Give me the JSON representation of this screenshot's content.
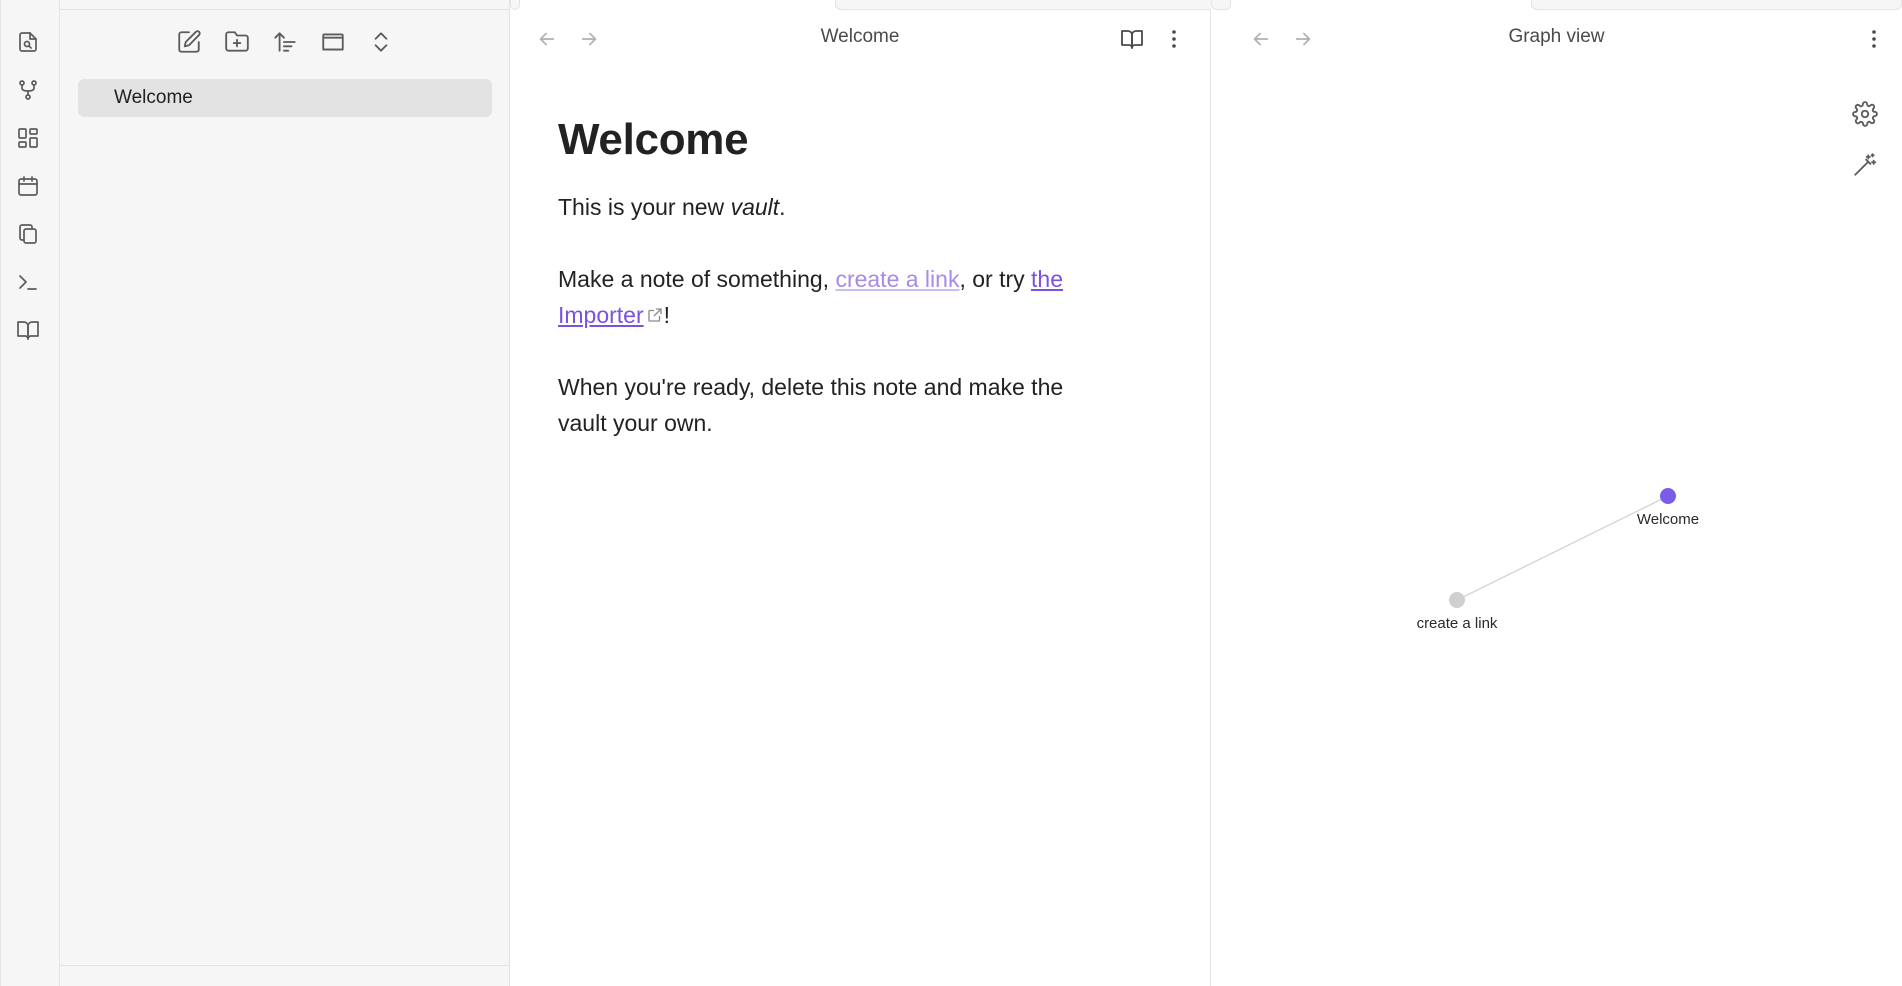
{
  "ribbon": {
    "items": [
      {
        "name": "open-quick-switcher-icon"
      },
      {
        "name": "graph-view-icon"
      },
      {
        "name": "canvas-icon"
      },
      {
        "name": "daily-note-icon"
      },
      {
        "name": "templates-icon"
      },
      {
        "name": "command-palette-icon"
      },
      {
        "name": "help-icon"
      }
    ]
  },
  "sidebar": {
    "toolbar": [
      "new-note-icon",
      "new-folder-icon",
      "sort-icon",
      "collapse-icon",
      "expand-all-icon"
    ],
    "files": [
      {
        "label": "Welcome"
      }
    ]
  },
  "editor": {
    "title": "Welcome",
    "note": {
      "heading": "Welcome",
      "p1_before": "This is your new ",
      "p1_em": "vault",
      "p1_after": ".",
      "p2_before": "Make a note of something, ",
      "p2_link1": "create a link",
      "p2_mid": ", or try ",
      "p2_link2a": "the ",
      "p2_link2b": "Importer",
      "p2_after": "!",
      "p3_line1": "When you're ready, delete this note and make the",
      "p3_line2": "vault your own."
    }
  },
  "graph": {
    "title": "Graph view",
    "nodes": [
      {
        "label": "Welcome",
        "color": "#7c5be8"
      },
      {
        "label": "create a link",
        "color": "#d0d0d0"
      }
    ],
    "edge_color": "#d4d4d4"
  },
  "colors": {
    "accent": "#7b52e0",
    "internal_link": "#a88be6",
    "sidebar_bg": "#f6f6f6",
    "active_file_bg": "#e3e3e3"
  }
}
